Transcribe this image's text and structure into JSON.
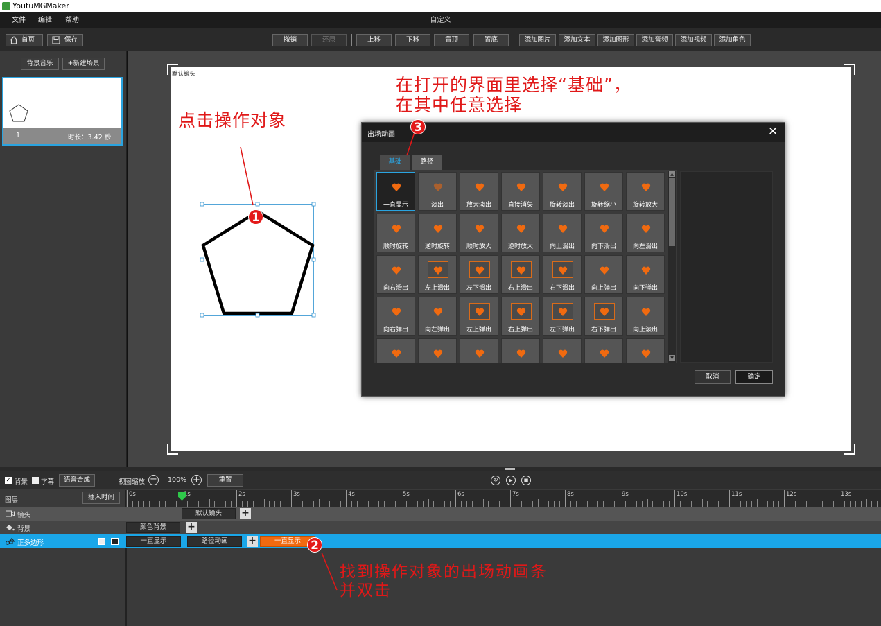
{
  "app": {
    "title": "YoutuMGMaker"
  },
  "menu": {
    "items": [
      "文件",
      "编辑",
      "帮助"
    ],
    "document_title": "自定义"
  },
  "toolbar": {
    "home_label": "首页",
    "save_label": "保存",
    "undo": "撤销",
    "redo": "还原",
    "move_up": "上移",
    "move_down": "下移",
    "to_top": "置顶",
    "to_bottom": "置底",
    "add_image": "添加图片",
    "add_text": "添加文本",
    "add_shape": "添加图形",
    "add_audio": "添加音频",
    "add_video": "添加视频",
    "add_role": "添加角色"
  },
  "scene_panel": {
    "bg_music": "背景音乐",
    "new_scene": "+新建场景",
    "scene": {
      "index": "1",
      "duration": "时长：3.42 秒"
    }
  },
  "stage": {
    "camera_label": "默认镜头"
  },
  "annotations": {
    "a1": "点击操作对象",
    "a2_line1": "找到操作对象的出场动画条",
    "a2_line2": "并双击",
    "a3_line1": "在打开的界面里选择“基础”，",
    "a3_line2": "在其中任意选择",
    "badges": [
      "1",
      "2",
      "3"
    ]
  },
  "dialog": {
    "title": "出场动画",
    "close": "✕",
    "tabs": [
      "基础",
      "路径"
    ],
    "active_tab": 0,
    "items": [
      "一直显示",
      "淡出",
      "放大淡出",
      "直接消失",
      "旋转淡出",
      "旋转缩小",
      "旋转放大",
      "顺时旋转",
      "逆时旋转",
      "顺时放大",
      "逆时放大",
      "向上滑出",
      "向下滑出",
      "向左滑出",
      "向右滑出",
      "左上滑出",
      "左下滑出",
      "右上滑出",
      "右下滑出",
      "向上弹出",
      "向下弹出",
      "向右弹出",
      "向左弹出",
      "左上弹出",
      "右上弹出",
      "左下弹出",
      "右下弹出",
      "向上滚出",
      "",
      "",
      "",
      "",
      "",
      "",
      ""
    ],
    "cancel": "取消",
    "ok": "确定"
  },
  "timeline": {
    "chk_bg": "背景",
    "chk_subtitle": "字幕",
    "tts": "语音合成",
    "zoom_label": "视图缩放",
    "zoom_value": "100%",
    "reset": "重置",
    "layer_header": "图层",
    "insert_time": "插入时间",
    "ticks": [
      "0s",
      "1s",
      "2s",
      "3s",
      "4s",
      "5s",
      "6s",
      "7s",
      "8s",
      "9s",
      "10s",
      "11s",
      "12s",
      "13s"
    ],
    "tracks": [
      {
        "name": "镜头",
        "clips": [
          "默认镜头"
        ]
      },
      {
        "name": "背景",
        "clips": [
          "颜色背景"
        ]
      },
      {
        "name": "正多边形",
        "clips": [
          "一直显示",
          "路径动画",
          "一直显示"
        ]
      }
    ]
  },
  "colors": {
    "accent_orange": "#f06a10",
    "selected_track": "#1aa6e8",
    "annotation_red": "#e01818",
    "playhead_green": "#2ec84a"
  }
}
